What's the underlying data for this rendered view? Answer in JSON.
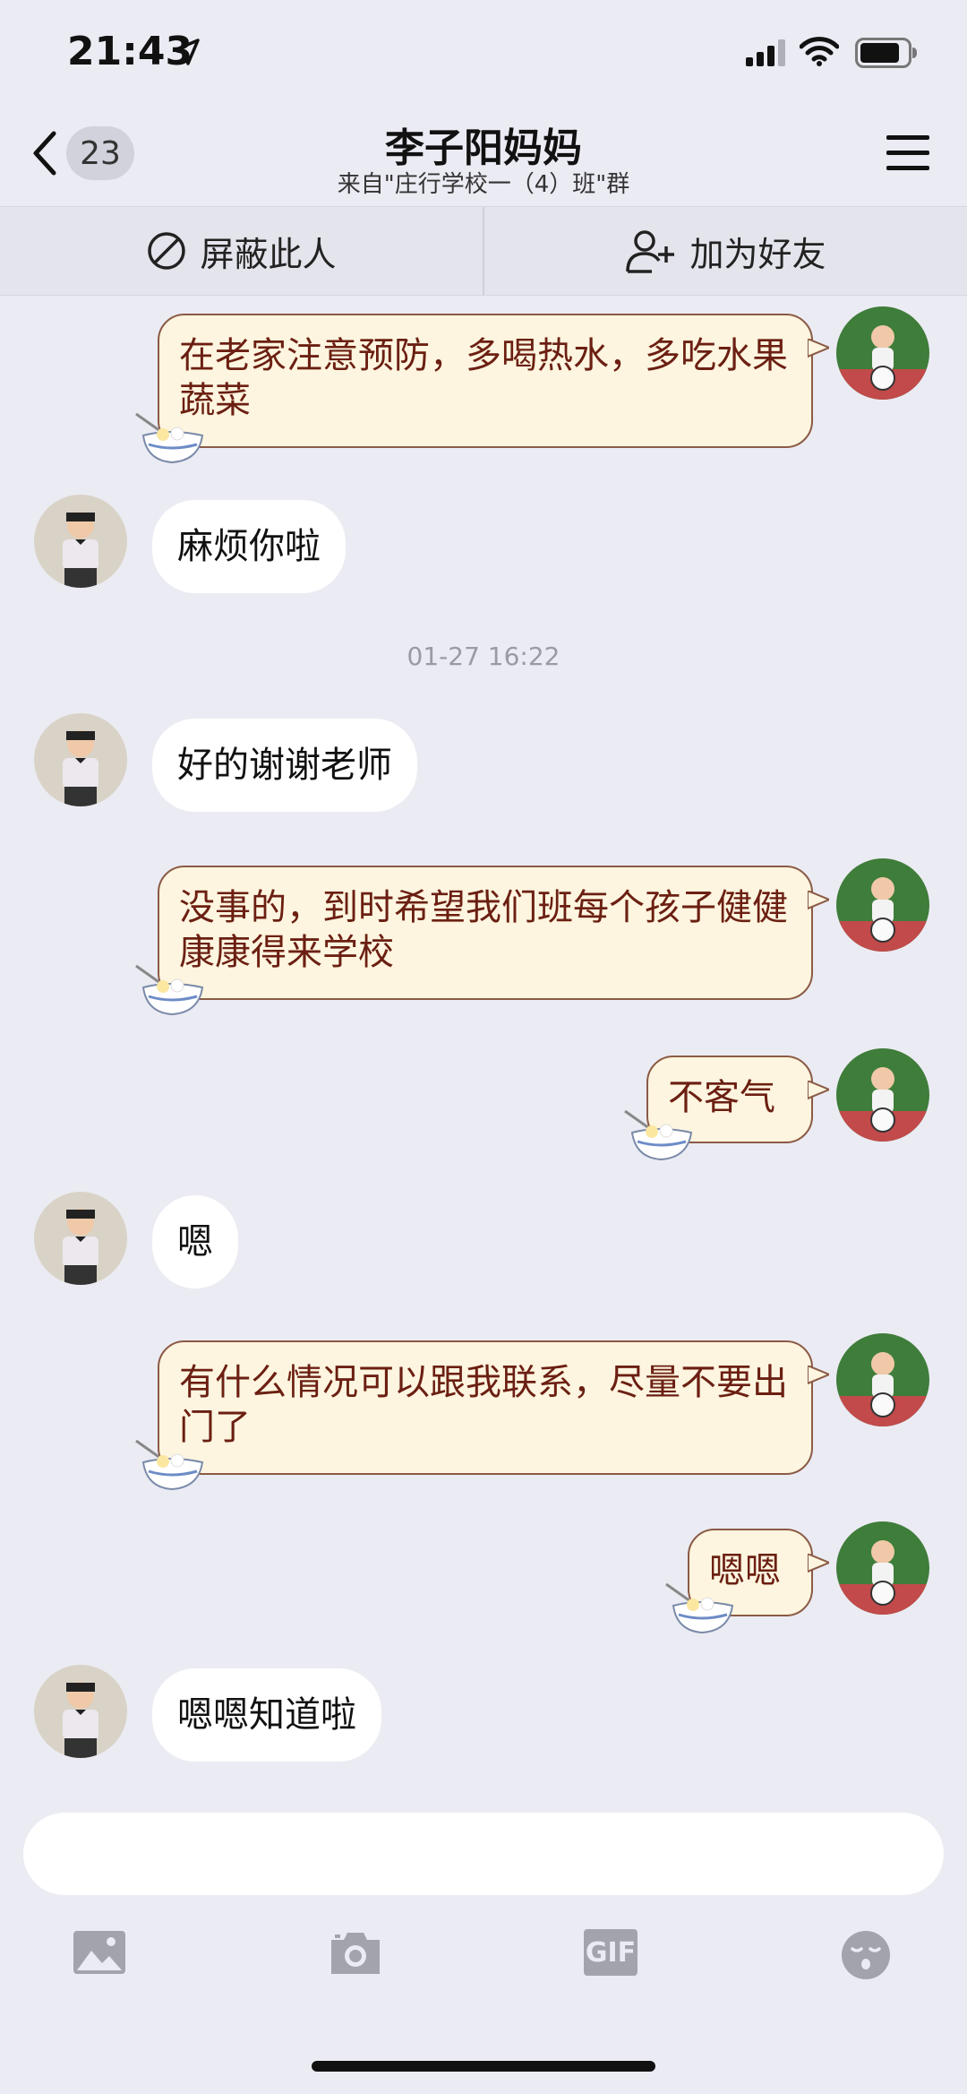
{
  "status_bar": {
    "time": "21:43"
  },
  "nav": {
    "unread_count": "23",
    "title": "李子阳妈妈",
    "subtitle": "来自\"庄行学校一（4）班\"群"
  },
  "actions": {
    "block": "屏蔽此人",
    "add_friend": "加为好友"
  },
  "messages": [
    {
      "side": "out",
      "text": "在老家注意预防，多喝热水，多吃水果蔬菜"
    },
    {
      "side": "in",
      "text": "麻烦你啦"
    },
    {
      "side": "time",
      "text": "01-27 16:22"
    },
    {
      "side": "in",
      "text": "好的谢谢老师"
    },
    {
      "side": "out",
      "text": "没事的，到时希望我们班每个孩子健健康康得来学校"
    },
    {
      "side": "out",
      "text": "不客气"
    },
    {
      "side": "in",
      "text": "嗯"
    },
    {
      "side": "out",
      "text": "有什么情况可以跟我联系，尽量不要出门了"
    },
    {
      "side": "out",
      "text": "嗯嗯"
    },
    {
      "side": "in",
      "text": "嗯嗯知道啦"
    }
  ],
  "input": {
    "placeholder": ""
  },
  "toolbar": {
    "gif_label": "GIF"
  },
  "colors": {
    "background": "#ebebf3",
    "bubble_out_fill": "#fdf5df",
    "bubble_out_border": "#8b5a45",
    "bubble_out_text": "#6b1f12",
    "bubble_in_fill": "#ffffff"
  }
}
